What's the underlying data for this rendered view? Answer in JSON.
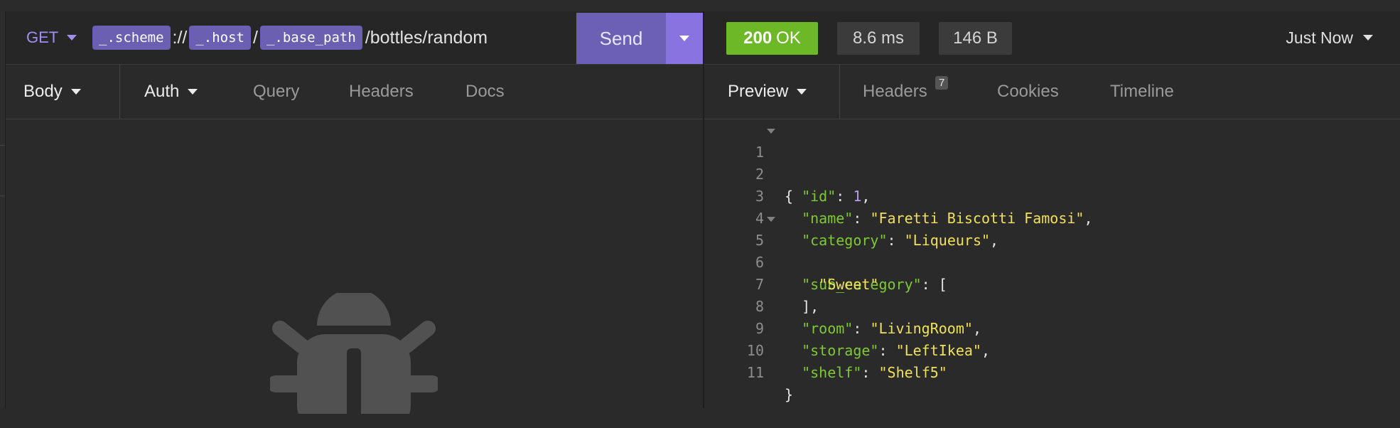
{
  "request": {
    "method": "GET",
    "url": {
      "scheme_tag": "_.scheme",
      "sep1": "://",
      "host_tag": "_.host",
      "sep2": "/",
      "base_path_tag": "_.base_path",
      "path": "/bottles/random"
    },
    "send_label": "Send",
    "tabs": [
      {
        "label": "Body"
      },
      {
        "label": "Auth"
      },
      {
        "label": "Query"
      },
      {
        "label": "Headers"
      },
      {
        "label": "Docs"
      }
    ]
  },
  "response": {
    "status_code": "200",
    "status_text": "OK",
    "time": "8.6 ms",
    "size": "146 B",
    "history": "Just Now",
    "tabs": [
      {
        "label": "Preview"
      },
      {
        "label": "Headers",
        "count": "7"
      },
      {
        "label": "Cookies"
      },
      {
        "label": "Timeline"
      }
    ],
    "json_lines": [
      {
        "n": "1",
        "p1": "{"
      },
      {
        "n": "2",
        "k": "\"id\"",
        "p1": ": ",
        "num": "1",
        "p2": ","
      },
      {
        "n": "3",
        "k": "\"name\"",
        "p1": ": ",
        "s": "\"Faretti Biscotti Famosi\"",
        "p2": ","
      },
      {
        "n": "4",
        "k": "\"category\"",
        "p1": ": ",
        "s": "\"Liqueurs\"",
        "p2": ","
      },
      {
        "n": "5",
        "k": "\"sub_category\"",
        "p1": ": ["
      },
      {
        "n": "6",
        "s": "\"Sweet\""
      },
      {
        "n": "7",
        "p1": "],"
      },
      {
        "n": "8",
        "k": "\"room\"",
        "p1": ": ",
        "s": "\"LivingRoom\"",
        "p2": ","
      },
      {
        "n": "9",
        "k": "\"storage\"",
        "p1": ": ",
        "s": "\"LeftIkea\"",
        "p2": ","
      },
      {
        "n": "10",
        "k": "\"shelf\"",
        "p1": ": ",
        "s": "\"Shelf5\""
      },
      {
        "n": "11",
        "p1": "}"
      }
    ]
  },
  "icons": {
    "method_dropdown": "caret-down-icon",
    "send_dropdown": "caret-down-icon",
    "empty_state": "bug-icon"
  },
  "colors": {
    "accent": "#6b60b3",
    "accent_light": "#8873e0",
    "success": "#6db827",
    "json_key": "#7ec935",
    "json_string": "#f1e05a",
    "json_number": "#b59cf0"
  }
}
